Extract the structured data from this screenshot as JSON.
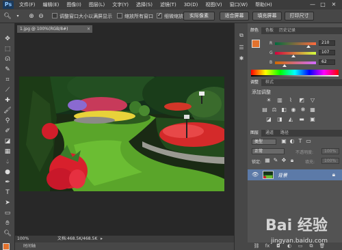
{
  "app": {
    "logo": "Ps"
  },
  "menubar": {
    "items": [
      "文件(F)",
      "编辑(E)",
      "图像(I)",
      "图层(L)",
      "文字(Y)",
      "选择(S)",
      "滤镜(T)",
      "3D(D)",
      "视图(V)",
      "窗口(W)",
      "帮助(H)"
    ],
    "minimize": "—",
    "restore": "□",
    "close": "✕"
  },
  "options": {
    "checkboxes": [
      {
        "label": "调整窗口大小以满屏显示",
        "checked": false
      },
      {
        "label": "缩放所有窗口",
        "checked": false
      },
      {
        "label": "细微缩放",
        "checked": true
      }
    ],
    "buttons": [
      "实际像素",
      "适合屏幕",
      "填充屏幕",
      "打印尺寸"
    ]
  },
  "document": {
    "tab_title": "1.jpg @ 100%(RGB/8#)",
    "tab_close": "×",
    "zoom": "100%",
    "doc_size": "文档:468.5K/468.5K",
    "bottom_tab": "时间轴"
  },
  "color_panel": {
    "tabs": [
      "颜色",
      "色板",
      "历史记录"
    ],
    "foreground": "#e2722e",
    "channels": [
      {
        "label": "R",
        "value": "210"
      },
      {
        "label": "G",
        "value": "107"
      },
      {
        "label": "B",
        "value": "62"
      }
    ]
  },
  "adjustments_panel": {
    "tabs": [
      "调整",
      "样式"
    ],
    "title": "添加调整"
  },
  "layers_panel": {
    "tabs": [
      "图层",
      "通道",
      "路径"
    ],
    "kind_label": "类型",
    "blend_mode": "正常",
    "opacity_label": "不透明度:",
    "opacity_value": "100%",
    "lock_label": "锁定:",
    "fill_label": "填充:",
    "fill_value": "100%",
    "layer_name": "背景"
  },
  "watermark": {
    "text": "Bai 经验",
    "url": "jingyan.baidu.com"
  }
}
